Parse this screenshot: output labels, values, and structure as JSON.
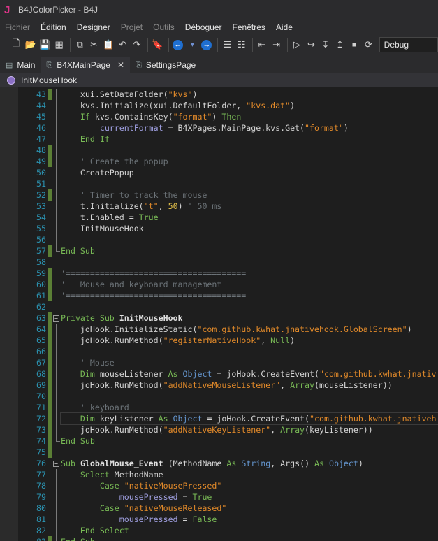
{
  "window": {
    "title": "B4JColorPicker - B4J",
    "logo": "J"
  },
  "menu": [
    {
      "label": "Fichier",
      "enabled": false
    },
    {
      "label": "Édition",
      "enabled": true
    },
    {
      "label": "Designer",
      "enabled": true
    },
    {
      "label": "Projet",
      "enabled": false
    },
    {
      "label": "Outils",
      "enabled": false
    },
    {
      "label": "Déboguer",
      "enabled": true
    },
    {
      "label": "Fenêtres",
      "enabled": true
    },
    {
      "label": "Aide",
      "enabled": true
    }
  ],
  "toolbar": {
    "icons": [
      "new-file-icon",
      "open-folder-icon",
      "save-icon",
      "save-all-icon",
      "|",
      "copy-icon",
      "cut-icon",
      "paste-icon",
      "undo-icon",
      "redo-icon",
      "|",
      "bookmark-icon",
      "|",
      "back-icon",
      "dropdown-icon",
      "forward-icon",
      "|",
      "comment-icon",
      "uncomment-icon",
      "|",
      "outdent-icon",
      "indent-icon",
      "|",
      "run-icon",
      "step-over-icon",
      "step-in-icon",
      "step-out-icon",
      "stop-icon",
      "restart-icon"
    ],
    "config": "Debug"
  },
  "tabs": [
    {
      "label": "Main",
      "active": false,
      "closable": false
    },
    {
      "label": "B4XMainPage",
      "active": true,
      "closable": true
    },
    {
      "label": "SettingsPage",
      "active": false,
      "closable": false
    }
  ],
  "subbar": {
    "label": "InitMouseHook"
  },
  "colors": {
    "keyword": "#78b955",
    "string": "#e28a2a",
    "comment": "#6c7378",
    "number": "#e8c44a",
    "line_number": "#2b91af",
    "change_marker": "#5b7f35"
  },
  "code": {
    "lines": [
      {
        "n": 43,
        "mk": true,
        "t": [
          [
            "    xui.SetDataFolder(",
            ""
          ],
          [
            "\"kvs\"",
            "str"
          ],
          [
            ")",
            ""
          ]
        ]
      },
      {
        "n": 44,
        "t": [
          [
            "    kvs.Initialize(xui.DefaultFolder, ",
            ""
          ],
          [
            "\"kvs.dat\"",
            "str"
          ],
          [
            ")",
            ""
          ]
        ]
      },
      {
        "n": 45,
        "t": [
          [
            "    ",
            ""
          ],
          [
            "If",
            "kw"
          ],
          [
            " kvs.ContainsKey(",
            ""
          ],
          [
            "\"format\"",
            "str"
          ],
          [
            ") ",
            ""
          ],
          [
            "Then",
            "kw"
          ]
        ]
      },
      {
        "n": 46,
        "t": [
          [
            "        ",
            ""
          ],
          [
            "currentFormat",
            "var"
          ],
          [
            " = B4XPages.MainPage.kvs.Get(",
            ""
          ],
          [
            "\"format\"",
            "str"
          ],
          [
            ")",
            ""
          ]
        ]
      },
      {
        "n": 47,
        "t": [
          [
            "    ",
            ""
          ],
          [
            "End If",
            "kw"
          ]
        ]
      },
      {
        "n": 48,
        "mk": true,
        "t": []
      },
      {
        "n": 49,
        "mk": true,
        "t": [
          [
            "    ' Create the popup",
            "cmt"
          ]
        ]
      },
      {
        "n": 50,
        "t": [
          [
            "    CreatePopup",
            ""
          ]
        ]
      },
      {
        "n": 51,
        "t": []
      },
      {
        "n": 52,
        "mk": true,
        "t": [
          [
            "    ' Timer to track the mouse",
            "cmt"
          ]
        ]
      },
      {
        "n": 53,
        "t": [
          [
            "    t.Initialize(",
            ""
          ],
          [
            "\"t\"",
            "str"
          ],
          [
            ", ",
            ""
          ],
          [
            "50",
            "num"
          ],
          [
            ") ",
            ""
          ],
          [
            "' 50 ms",
            "cmt"
          ]
        ]
      },
      {
        "n": 54,
        "t": [
          [
            "    t.Enabled = ",
            ""
          ],
          [
            "True",
            "kw"
          ]
        ]
      },
      {
        "n": 55,
        "t": [
          [
            "    InitMouseHook",
            ""
          ]
        ]
      },
      {
        "n": 56,
        "t": []
      },
      {
        "n": 57,
        "mk": true,
        "fold": "end",
        "t": [
          [
            "End Sub",
            "kw"
          ]
        ]
      },
      {
        "n": 58,
        "t": []
      },
      {
        "n": 59,
        "mk": true,
        "t": [
          [
            "'=====================================",
            "cmt"
          ]
        ]
      },
      {
        "n": 60,
        "mk": true,
        "t": [
          [
            "'   Mouse and keyboard management",
            "cmt"
          ]
        ]
      },
      {
        "n": 61,
        "mk": true,
        "t": [
          [
            "'=====================================",
            "cmt"
          ]
        ]
      },
      {
        "n": 62,
        "t": []
      },
      {
        "n": 63,
        "mk": true,
        "fold": "open",
        "t": [
          [
            "Private Sub",
            "kw"
          ],
          [
            " ",
            ""
          ],
          [
            "InitMouseHook",
            "bold"
          ]
        ]
      },
      {
        "n": 64,
        "mk": true,
        "t": [
          [
            "    joHook.InitializeStatic(",
            ""
          ],
          [
            "\"com.github.kwhat.jnativehook.GlobalScreen\"",
            "str"
          ],
          [
            ")",
            ""
          ]
        ]
      },
      {
        "n": 65,
        "mk": true,
        "t": [
          [
            "    joHook.RunMethod(",
            ""
          ],
          [
            "\"registerNativeHook\"",
            "str"
          ],
          [
            ", ",
            ""
          ],
          [
            "Null",
            "kw"
          ],
          [
            ")",
            ""
          ]
        ]
      },
      {
        "n": 66,
        "mk": true,
        "t": []
      },
      {
        "n": 67,
        "mk": true,
        "t": [
          [
            "    ' Mouse",
            "cmt"
          ]
        ]
      },
      {
        "n": 68,
        "mk": true,
        "t": [
          [
            "    ",
            ""
          ],
          [
            "Dim",
            "kw"
          ],
          [
            " mouseListener ",
            ""
          ],
          [
            "As",
            "kw"
          ],
          [
            " ",
            ""
          ],
          [
            "Object",
            "type"
          ],
          [
            " = joHook.CreateEvent(",
            ""
          ],
          [
            "\"com.github.kwhat.jnativ",
            "str"
          ]
        ]
      },
      {
        "n": 69,
        "mk": true,
        "t": [
          [
            "    joHook.RunMethod(",
            ""
          ],
          [
            "\"addNativeMouseListener\"",
            "str"
          ],
          [
            ", ",
            ""
          ],
          [
            "Array",
            "kw"
          ],
          [
            "(mouseListener))",
            ""
          ]
        ]
      },
      {
        "n": 70,
        "mk": true,
        "t": []
      },
      {
        "n": 71,
        "mk": true,
        "t": [
          [
            "    ' keyboard",
            "cmt"
          ]
        ]
      },
      {
        "n": 72,
        "mk": true,
        "cur": true,
        "t": [
          [
            "    ",
            ""
          ],
          [
            "Dim",
            "kw"
          ],
          [
            " keyListener ",
            ""
          ],
          [
            "As",
            "kw"
          ],
          [
            " ",
            ""
          ],
          [
            "Object",
            "type"
          ],
          [
            " = joHook.CreateEvent(",
            ""
          ],
          [
            "\"com.github.kwhat.jnativeh",
            "str"
          ]
        ]
      },
      {
        "n": 73,
        "mk": true,
        "t": [
          [
            "    joHook.RunMethod(",
            ""
          ],
          [
            "\"addNativeKeyListener\"",
            "str"
          ],
          [
            ", ",
            ""
          ],
          [
            "Array",
            "kw"
          ],
          [
            "(keyListener))",
            ""
          ]
        ]
      },
      {
        "n": 74,
        "mk": true,
        "fold": "end",
        "t": [
          [
            "End Sub",
            "kw"
          ]
        ]
      },
      {
        "n": 75,
        "mk": true,
        "t": []
      },
      {
        "n": 76,
        "fold": "open",
        "t": [
          [
            "Sub",
            "kw"
          ],
          [
            " ",
            ""
          ],
          [
            "GlobalMouse_Event",
            "bold"
          ],
          [
            " (MethodName ",
            ""
          ],
          [
            "As",
            "kw"
          ],
          [
            " ",
            ""
          ],
          [
            "String",
            "type"
          ],
          [
            ", Args() ",
            ""
          ],
          [
            "As",
            "kw"
          ],
          [
            " ",
            ""
          ],
          [
            "Object",
            "type"
          ],
          [
            ")",
            ""
          ]
        ]
      },
      {
        "n": 77,
        "t": [
          [
            "    ",
            ""
          ],
          [
            "Select",
            "kw"
          ],
          [
            " MethodName",
            ""
          ]
        ]
      },
      {
        "n": 78,
        "t": [
          [
            "        ",
            ""
          ],
          [
            "Case",
            "kw"
          ],
          [
            " ",
            ""
          ],
          [
            "\"nativeMousePressed\"",
            "str"
          ]
        ]
      },
      {
        "n": 79,
        "t": [
          [
            "            ",
            ""
          ],
          [
            "mousePressed",
            "var"
          ],
          [
            " = ",
            ""
          ],
          [
            "True",
            "kw"
          ]
        ]
      },
      {
        "n": 80,
        "t": [
          [
            "        ",
            ""
          ],
          [
            "Case",
            "kw"
          ],
          [
            " ",
            ""
          ],
          [
            "\"nativeMouseReleased\"",
            "str"
          ]
        ]
      },
      {
        "n": 81,
        "t": [
          [
            "            ",
            ""
          ],
          [
            "mousePressed",
            "var"
          ],
          [
            " = ",
            ""
          ],
          [
            "False",
            "kw"
          ]
        ]
      },
      {
        "n": 82,
        "t": [
          [
            "    ",
            ""
          ],
          [
            "End Select",
            "kw"
          ]
        ]
      },
      {
        "n": 83,
        "mk": true,
        "fold": "end",
        "t": [
          [
            "End Sub",
            "kw"
          ]
        ]
      }
    ]
  }
}
